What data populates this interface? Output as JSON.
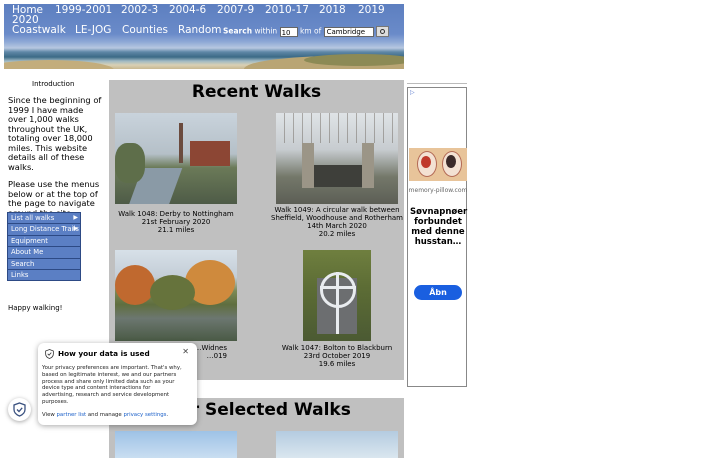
{
  "nav": {
    "row1": [
      "Home",
      "1999-2001",
      "2002-3",
      "2004-6",
      "2007-9",
      "2010-17",
      "2018",
      "2019"
    ],
    "row2": "2020",
    "row3": [
      "Coastwalk",
      "LE-JOG",
      "Counties",
      "Random"
    ]
  },
  "search": {
    "label": "Search",
    "within": "within",
    "radius": "10",
    "km_of": "km of",
    "place": "Cambridge"
  },
  "intro": {
    "title": "Introduction",
    "para1": "Since the beginning of 1999 I have made over 1,000 walks throughout the UK, totaling over 18,000 miles. This website details all of these walks.",
    "para2": "Please use the menus below or at the top of the page to navigate around the site.",
    "happy": "Happy walking!"
  },
  "menu": [
    "List all walks",
    "Long Distance Trails",
    "Equipment",
    "About Me",
    "Search",
    "Links"
  ],
  "recent": {
    "title": "Recent Walks",
    "walks": [
      {
        "title": "Walk 1048: Derby to Nottingham",
        "date": "21st February 2020",
        "miles": "21.1 miles"
      },
      {
        "title": "Walk 1049: A circular walk between Sheffield, Woodhouse and Rotherham",
        "date": "14th March 2020",
        "miles": "20.2 miles"
      },
      {
        "title": "…Widnes",
        "date": "…019",
        "miles": ""
      },
      {
        "title": "Walk 1047: Bolton to Blackburn",
        "date": "23rd October 2019",
        "miles": "19.6 miles"
      }
    ]
  },
  "other": {
    "title": "…er Selected Walks"
  },
  "ad": {
    "source": "memory-pillow.com",
    "headline": "Søvnapnøer forbundet med denne husstan…",
    "button": "Åbn"
  },
  "privacy": {
    "title": "How your data is used",
    "body": "Your privacy preferences are important. That's why, based on legitimate interest, we and our partners process and share only limited data such as your device type and content interactions for advertising, research and service development purposes.",
    "view": "View",
    "partner_list": "partner list",
    "and_manage": "and manage",
    "privacy_settings": "privacy settings",
    "dot": "."
  }
}
